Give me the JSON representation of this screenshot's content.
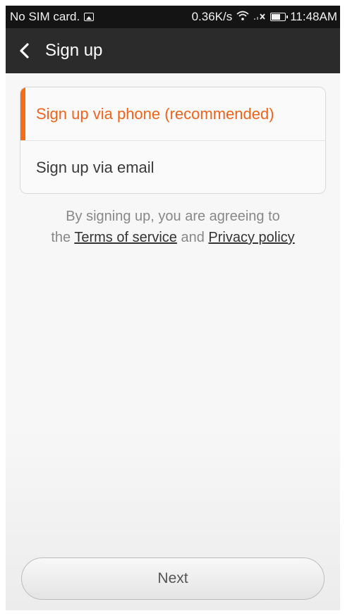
{
  "status_bar": {
    "carrier": "No SIM card.",
    "speed": "0.36K/s",
    "time": "11:48AM",
    "icons": [
      "image-notification-icon",
      "wifi-icon",
      "signal-icon",
      "battery-icon"
    ]
  },
  "header": {
    "title": "Sign up",
    "back_icon": "chevron-left-icon"
  },
  "options": [
    {
      "label": "Sign up via phone (recommended)",
      "active": true
    },
    {
      "label": "Sign up via email",
      "active": false
    }
  ],
  "terms": {
    "line1": "By signing up, you are agreeing to",
    "prefix": "the",
    "terms_link": "Terms of service",
    "and": "and",
    "privacy_link": "Privacy policy"
  },
  "footer": {
    "next_label": "Next"
  },
  "colors": {
    "accent": "#f86b1a",
    "titlebar": "#2b2b2b",
    "statusbar": "#141414"
  }
}
